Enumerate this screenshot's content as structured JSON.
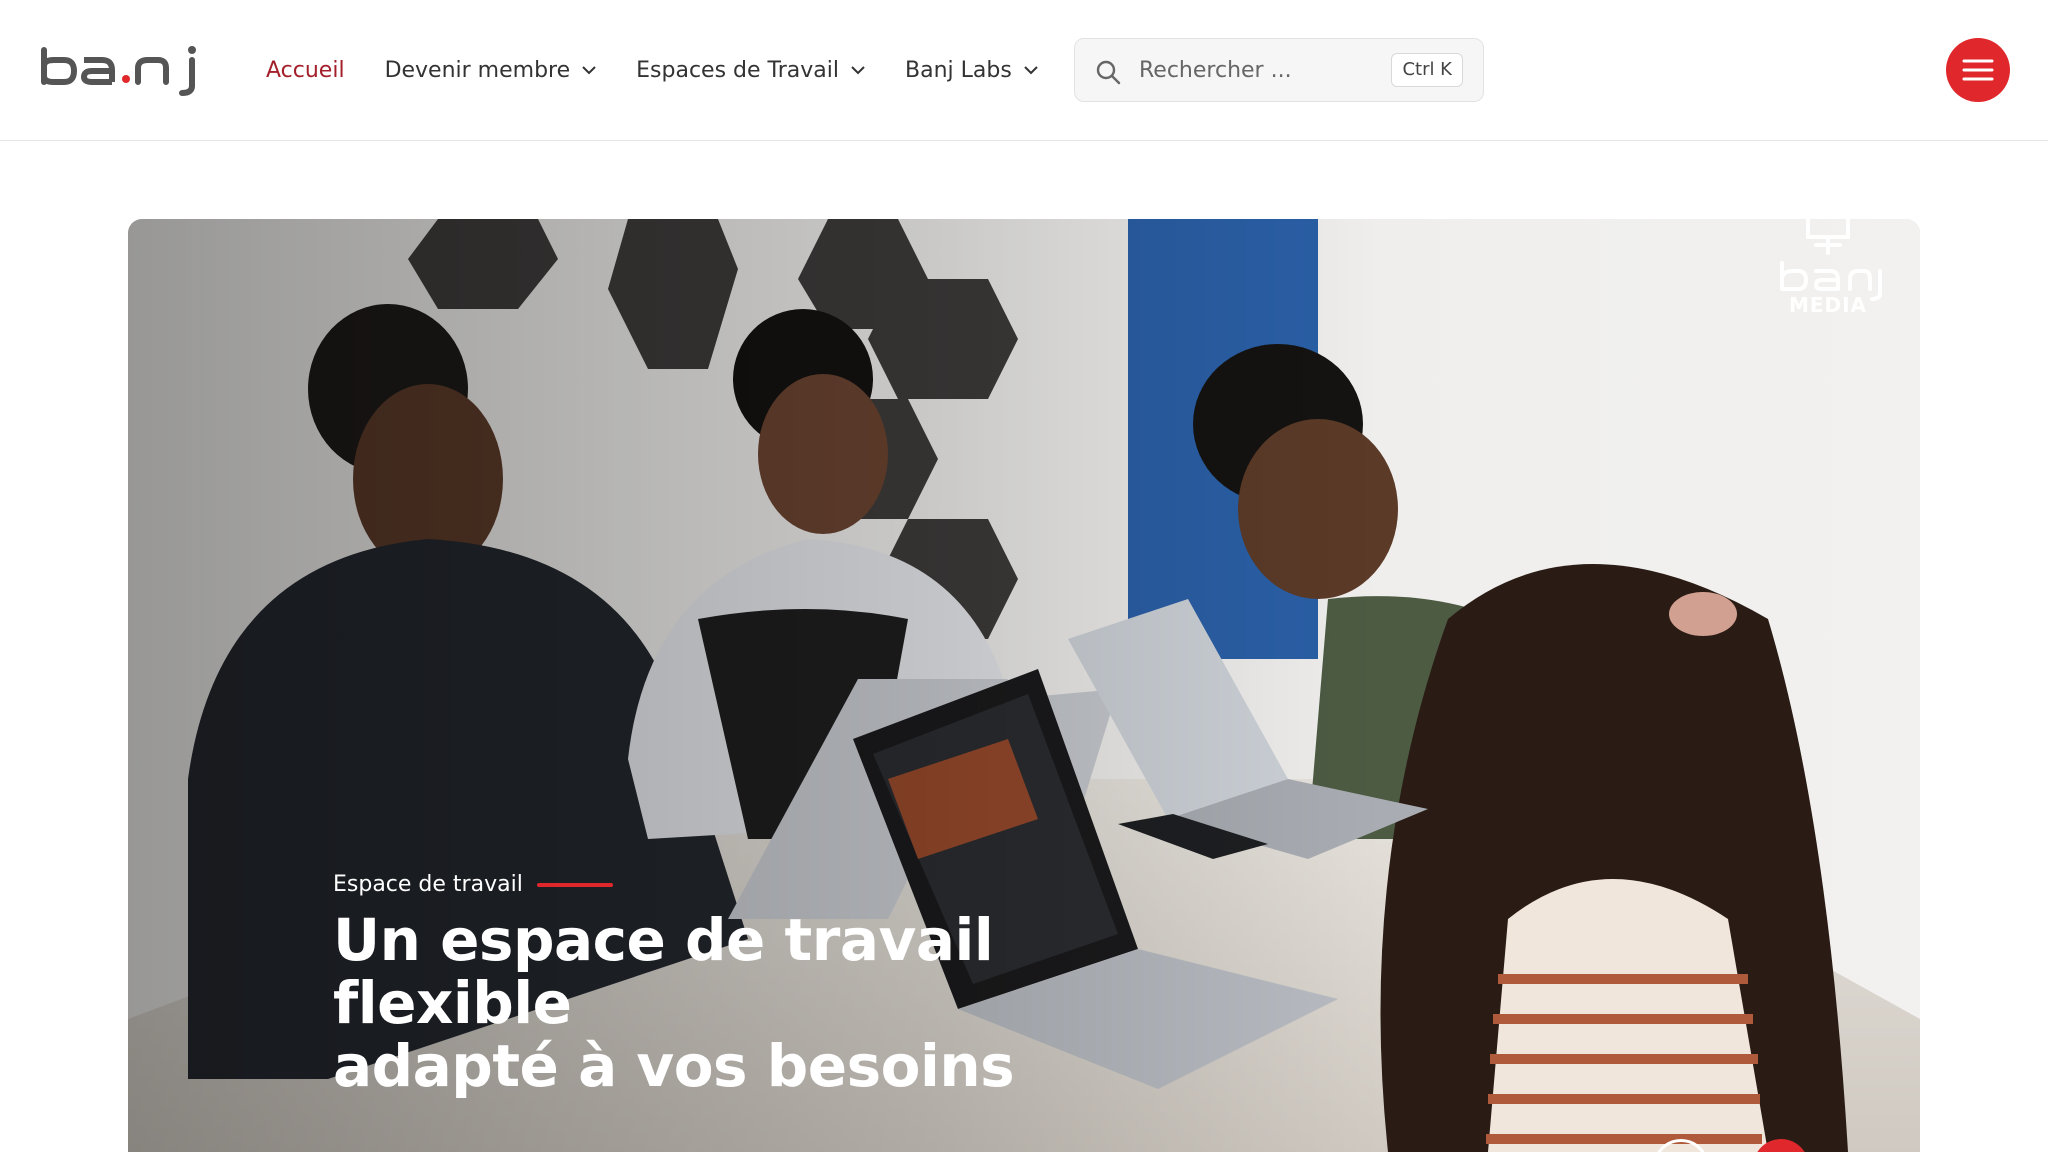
{
  "brand": {
    "logo_text": "banj",
    "accent": "#a3202a",
    "menu_color": "#e0282c"
  },
  "nav": {
    "items": [
      {
        "label": "Accueil",
        "active": true,
        "dropdown": false
      },
      {
        "label": "Devenir membre",
        "active": false,
        "dropdown": true
      },
      {
        "label": "Espaces de Travail",
        "active": false,
        "dropdown": true
      },
      {
        "label": "Banj Labs",
        "active": false,
        "dropdown": true
      }
    ]
  },
  "search": {
    "placeholder": "Rechercher ...",
    "shortcut": "Ctrl K"
  },
  "hero": {
    "watermark": "banj",
    "watermark_caption": "MEDIA",
    "tag": "Espace de travail",
    "title_line1": "Un espace de travail flexible",
    "title_line2": "adapté à vos besoins"
  },
  "icons": {
    "search": "search-icon",
    "chevron": "chevron-down-icon",
    "menu": "hamburger-menu-icon"
  }
}
